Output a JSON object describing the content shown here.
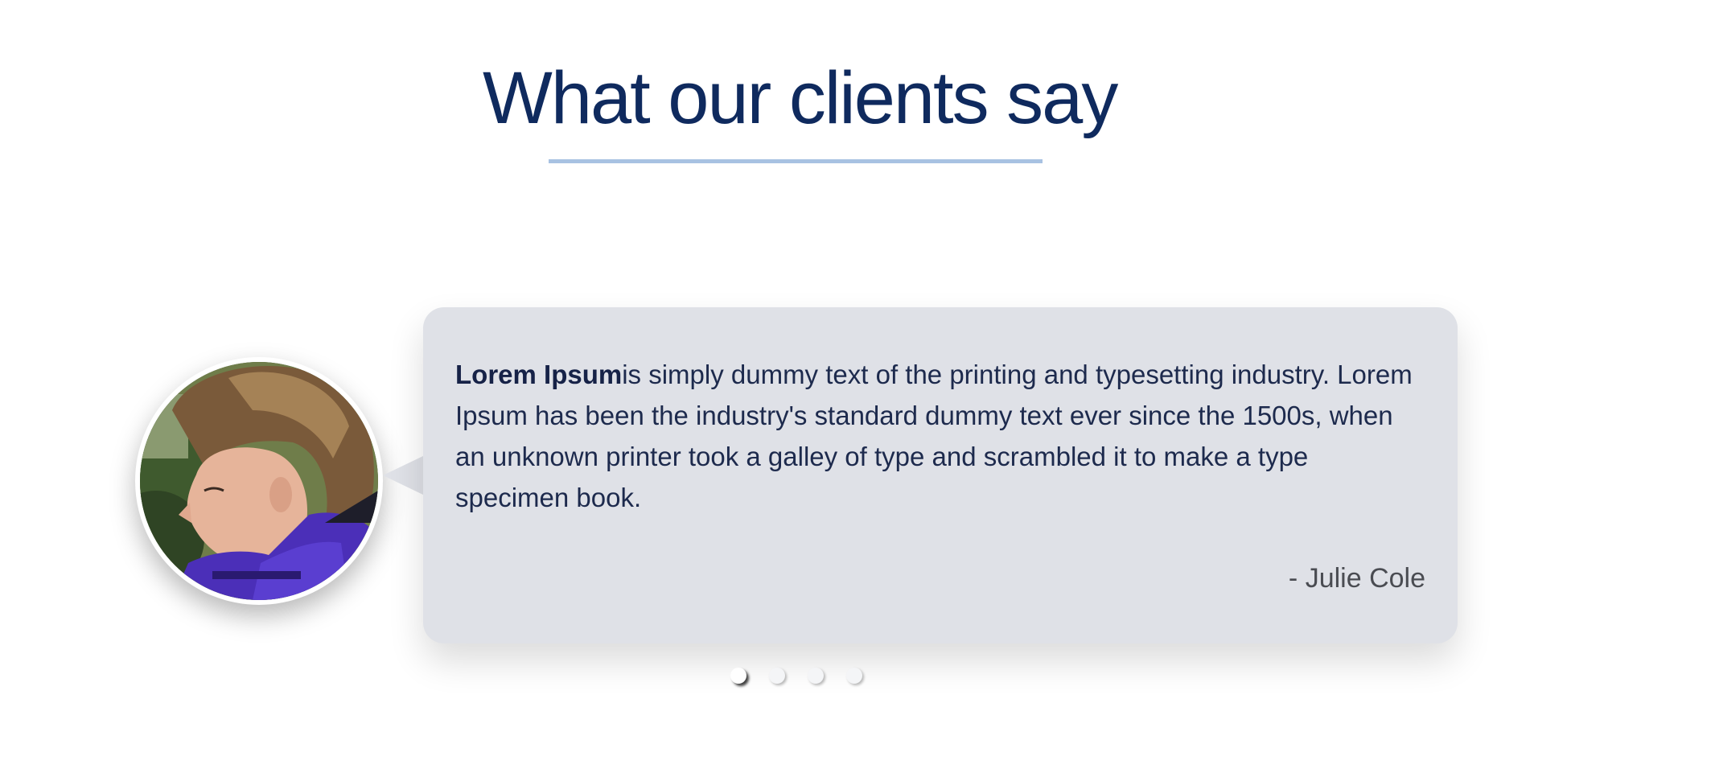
{
  "section": {
    "title": "What our clients say"
  },
  "testimonial": {
    "highlight": "Lorem Ipsum",
    "body": "is simply dummy text of the printing and typesetting industry. Lorem Ipsum has been the industry's standard dummy text ever since the 1500s, when an unknown printer took a galley of type and scrambled it to make a type specimen book.",
    "author": "- Julie Cole"
  },
  "carousel": {
    "slide_count": 4,
    "active_index": 0
  },
  "colors": {
    "title": "#0f2a5e",
    "underline": "#a8c2e2",
    "card_background": "#dfe1e7",
    "quote_text": "#1d2a4d",
    "author_text": "#4a4c52"
  },
  "icons": {
    "avatar": "client-portrait-photo"
  }
}
